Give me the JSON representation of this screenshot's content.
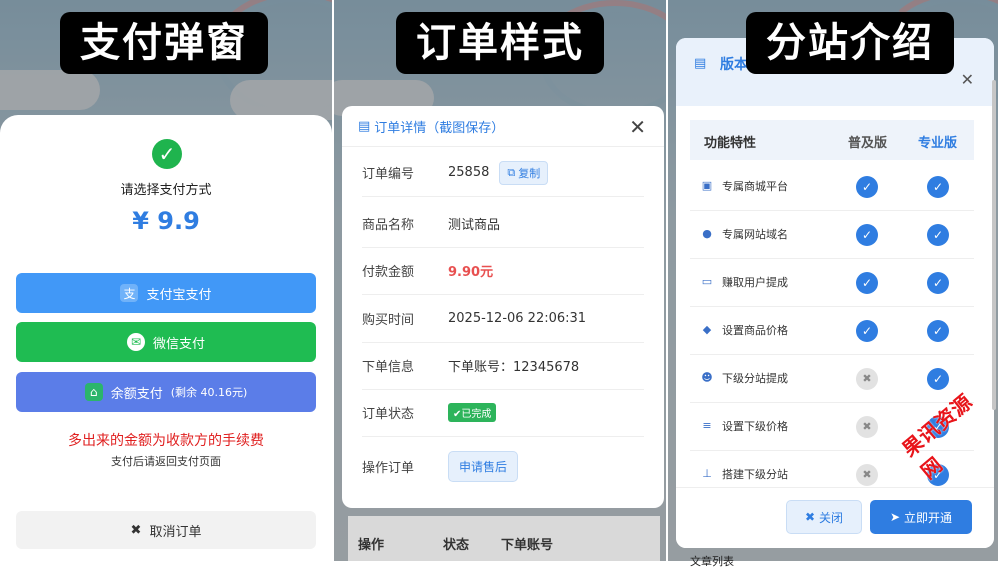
{
  "panel1": {
    "title": "支付弹窗",
    "prompt": "请选择支付方式",
    "price": "¥ 9.9",
    "alipay_label": "支付宝支付",
    "wechat_label": "微信支付",
    "balance_label": "余额支付",
    "balance_note": "(剩余 40.16元)",
    "fee_notice": "多出来的金额为收款方的手续费",
    "return_notice": "支付后请返回支付页面",
    "cancel_label": "取消订单",
    "colors": {
      "alipay": "#4198f7",
      "wechat": "#1fbc52",
      "balance": "#5b7de8"
    }
  },
  "panel2": {
    "title": "订单样式",
    "modal_title": "订单详情（截图保存）",
    "rows": [
      {
        "key": "订单编号",
        "value": "25858",
        "action": "复制"
      },
      {
        "key": "商品名称",
        "value": "测试商品"
      },
      {
        "key": "付款金额",
        "value": "9.90元"
      },
      {
        "key": "购买时间",
        "value": "2025-12-06 22:06:31"
      },
      {
        "key": "下单信息",
        "value": "下单账号：12345678"
      },
      {
        "key": "订单状态",
        "value": "✔已完成"
      },
      {
        "key": "操作订单",
        "value": "申请售后"
      }
    ],
    "table_headers": [
      "操作",
      "状态",
      "下单账号"
    ]
  },
  "panel3": {
    "title": "分站介绍",
    "header_partial": "版本",
    "columns": [
      "功能特性",
      "普及版",
      "专业版"
    ],
    "features": [
      {
        "name": "专属商城平台",
        "icon": "cart-icon",
        "basic": true,
        "pro": true
      },
      {
        "name": "专属网站域名",
        "icon": "globe-icon",
        "basic": true,
        "pro": true
      },
      {
        "name": "赚取用户提成",
        "icon": "money-icon",
        "basic": true,
        "pro": true
      },
      {
        "name": "设置商品价格",
        "icon": "tag-icon",
        "basic": true,
        "pro": true
      },
      {
        "name": "下级分站提成",
        "icon": "users-icon",
        "basic": false,
        "pro": true
      },
      {
        "name": "设置下级价格",
        "icon": "sliders-icon",
        "basic": false,
        "pro": true
      },
      {
        "name": "搭建下级分站",
        "icon": "sitemap-icon",
        "basic": false,
        "pro": true
      }
    ],
    "close_label": "关闭",
    "open_label": "立即开通",
    "below_text": "文章列表"
  },
  "watermark": "果讯资源网"
}
